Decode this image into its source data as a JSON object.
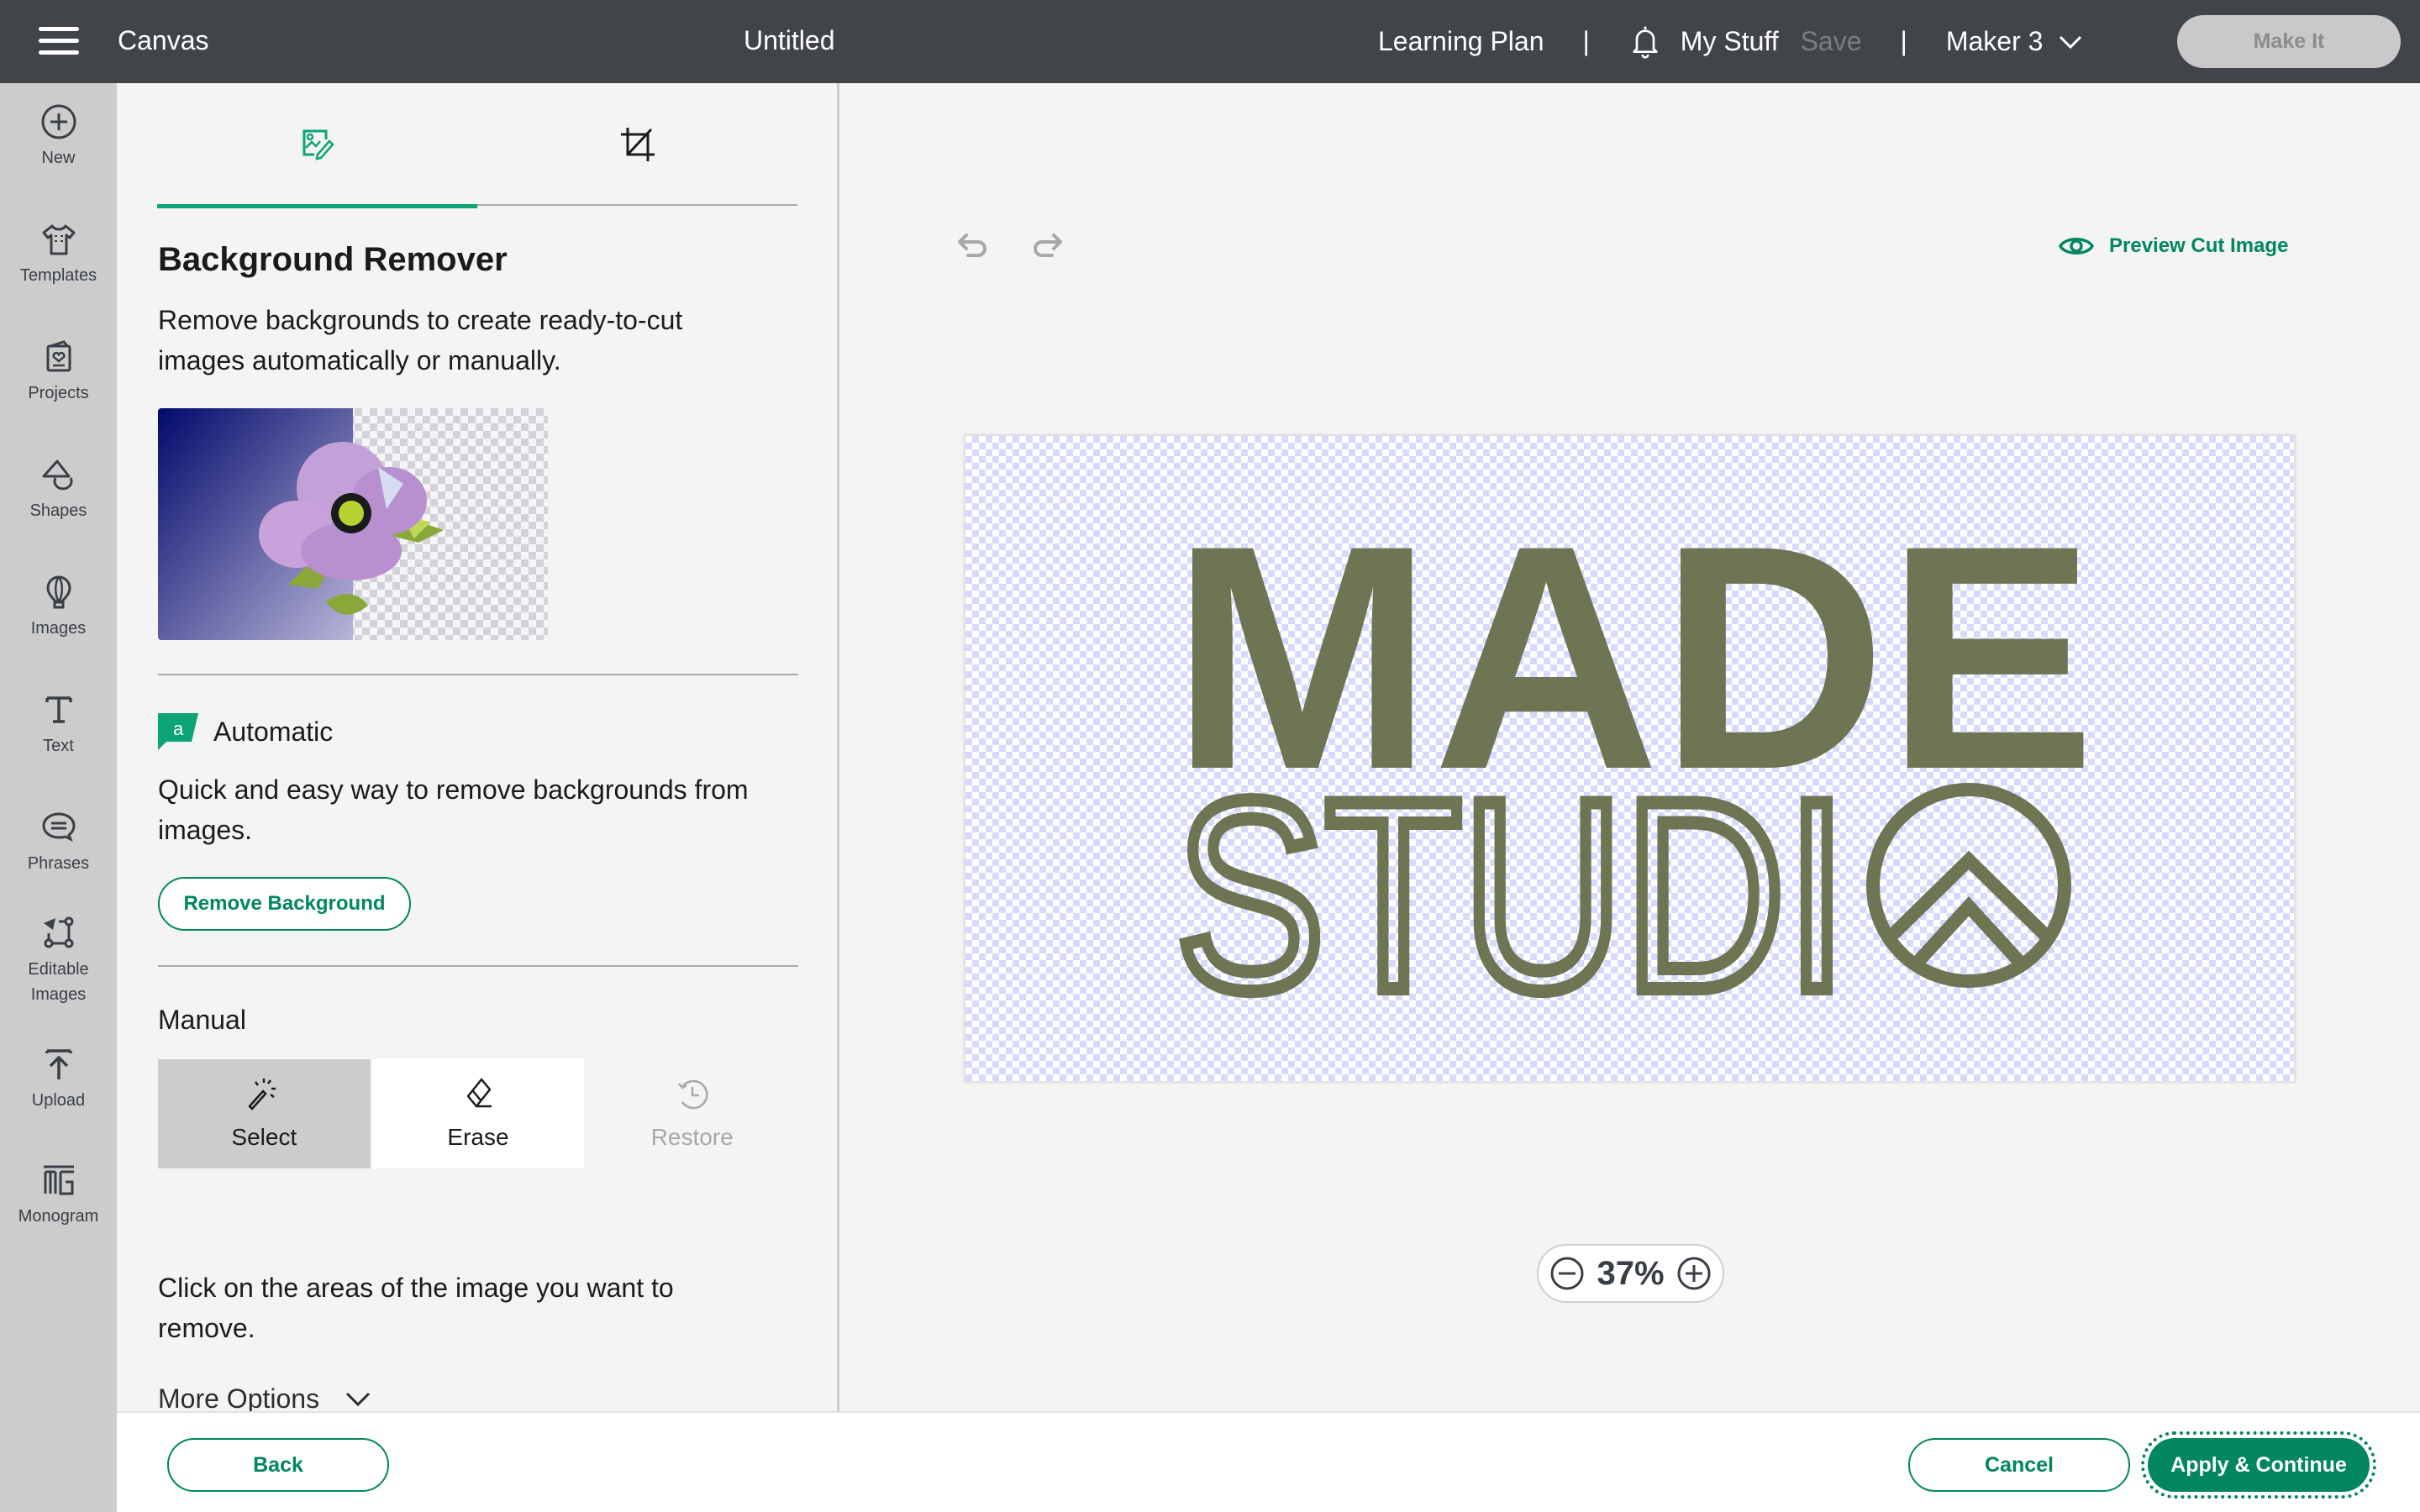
{
  "header": {
    "app_name": "Canvas",
    "document_title": "Untitled",
    "learning_plan": "Learning Plan",
    "separator": "|",
    "my_stuff": "My Stuff",
    "save": "Save",
    "machine": "Maker 3",
    "make_it": "Make It"
  },
  "sidebar": {
    "items": [
      {
        "label": "New",
        "icon": "plus-circle-icon"
      },
      {
        "label": "Templates",
        "icon": "tshirt-icon"
      },
      {
        "label": "Projects",
        "icon": "projects-icon"
      },
      {
        "label": "Shapes",
        "icon": "shapes-icon"
      },
      {
        "label": "Images",
        "icon": "balloon-icon"
      },
      {
        "label": "Text",
        "icon": "text-icon"
      },
      {
        "label": "Phrases",
        "icon": "speech-bubble-icon"
      },
      {
        "label": "Editable",
        "label2": "Images",
        "icon": "editable-image-icon"
      },
      {
        "label": "Upload",
        "icon": "upload-icon"
      },
      {
        "label": "Monogram",
        "icon": "monogram-icon"
      }
    ]
  },
  "panel": {
    "tabs": [
      {
        "name": "background-remover",
        "icon": "image-edit-icon",
        "active": true
      },
      {
        "name": "crop",
        "icon": "crop-icon",
        "active": false
      }
    ],
    "title": "Background Remover",
    "description_line1": "Remove backgrounds to create ready-to-cut",
    "description_line2": "images automatically or manually.",
    "automatic": {
      "label": "Automatic",
      "badge_letter": "a",
      "description_line1": "Quick and easy way to remove backgrounds from",
      "description_line2": "images.",
      "button": "Remove Background"
    },
    "manual": {
      "label": "Manual",
      "tools": [
        {
          "label": "Select",
          "icon": "magic-wand-icon",
          "state": "selected"
        },
        {
          "label": "Erase",
          "icon": "eraser-icon",
          "state": "normal"
        },
        {
          "label": "Restore",
          "icon": "restore-icon",
          "state": "disabled"
        }
      ],
      "instruction_line1": "Click on the areas of the image you want to",
      "instruction_line2": "remove.",
      "more_options": "More Options"
    }
  },
  "canvas": {
    "preview_cut": "Preview Cut Image",
    "image_text_top": "MADE",
    "image_text_bottom": "STUDI",
    "logo_color": "#6d7552",
    "zoom_level": "37%"
  },
  "footer": {
    "back": "Back",
    "cancel": "Cancel",
    "apply": "Apply & Continue"
  },
  "colors": {
    "accent": "#018660",
    "accent_bright": "#0aa476",
    "header_bg": "#414549",
    "sidebar_bg": "#cccccc"
  }
}
